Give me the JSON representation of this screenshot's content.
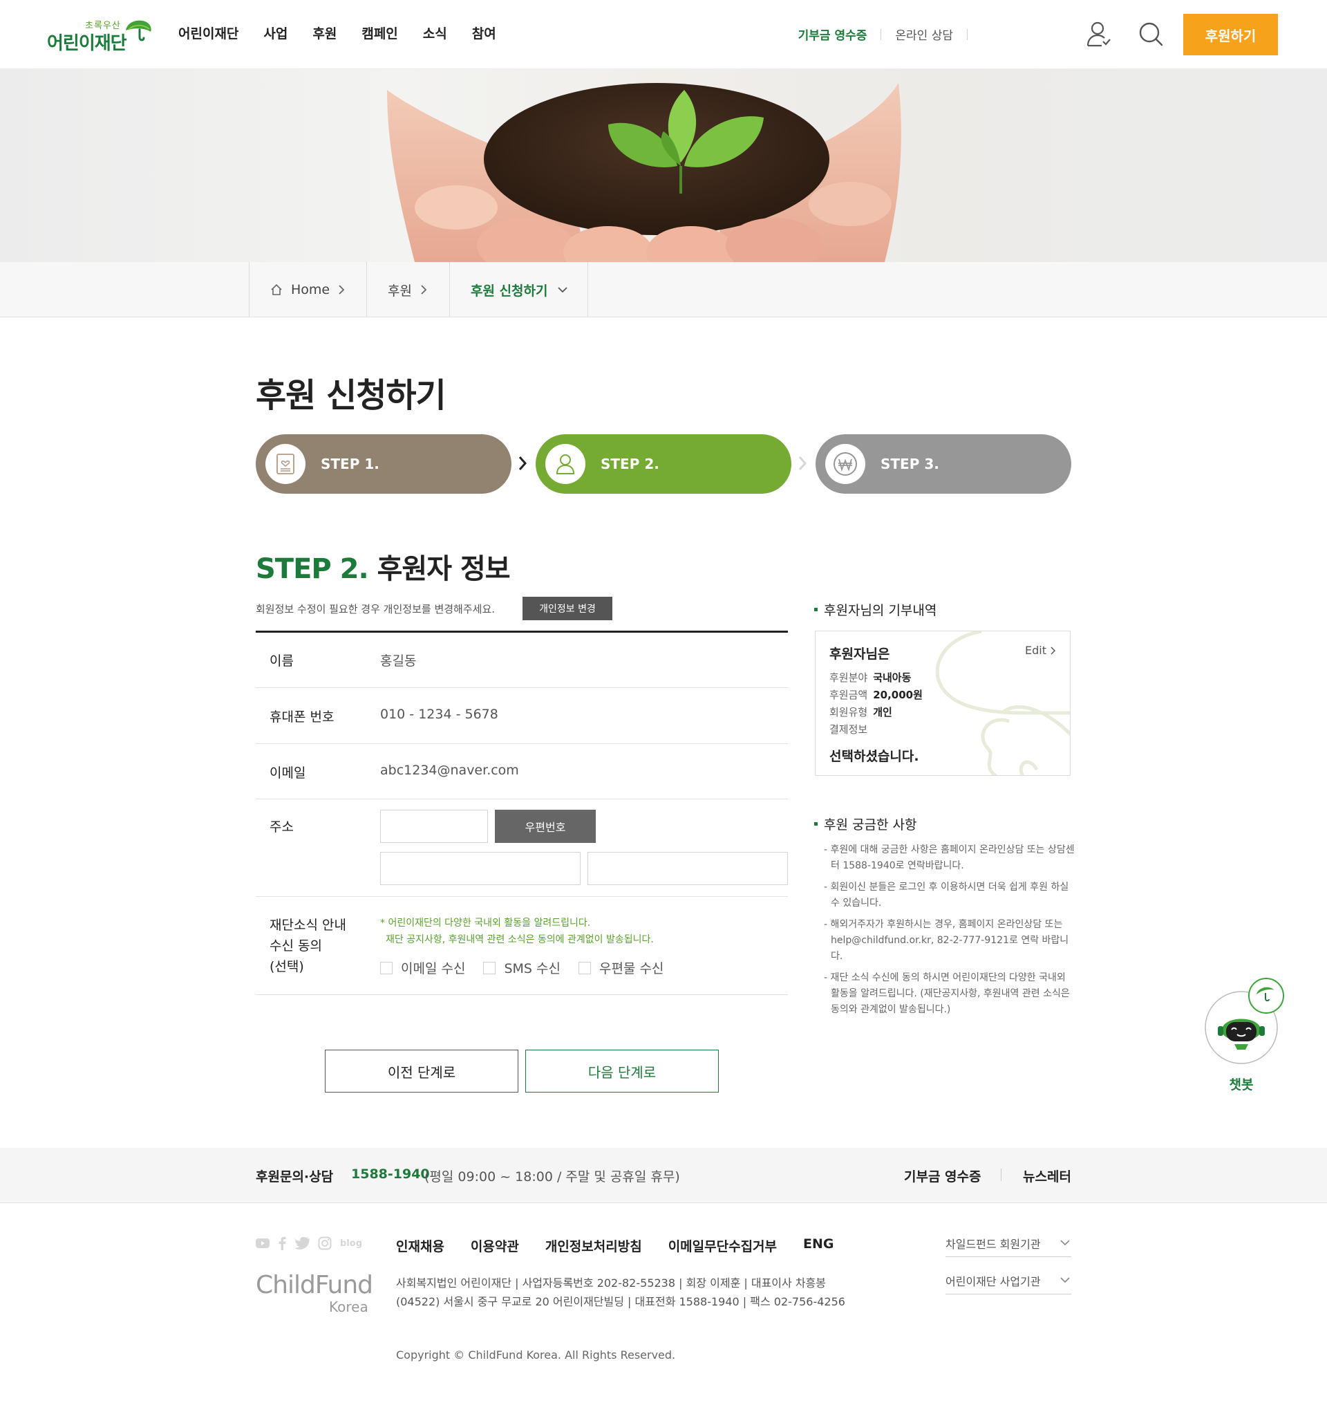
{
  "header": {
    "logo_small": "초록우산",
    "logo_main": "어린이재단",
    "nav": [
      "어린이재단",
      "사업",
      "후원",
      "캠페인",
      "소식",
      "참여"
    ],
    "receipt": "기부금 영수증",
    "consult": "온라인 상담",
    "donate_button": "후원하기"
  },
  "breadcrumb": {
    "home": "Home",
    "level1": "후원",
    "current": "후원 신청하기"
  },
  "page_title": "후원 신청하기",
  "steps": [
    {
      "label": "STEP 1.",
      "icon": "document-heart-icon",
      "color": "#928270"
    },
    {
      "label": "STEP 2.",
      "icon": "person-icon",
      "color": "#75ab32"
    },
    {
      "label": "STEP 3.",
      "icon": "won-coin-icon",
      "color": "#979797"
    }
  ],
  "section": {
    "step_label": "STEP 2.",
    "title": "후원자 정보",
    "note": "회원정보 수정이 필요한 경우 개인정보를 변경해주세요.",
    "change_button": "개인정보 변경"
  },
  "form": {
    "name_label": "이름",
    "name_value": "홍길동",
    "phone_label": "휴대폰 번호",
    "phone_value": "010 - 1234 - 5678",
    "email_label": "이메일",
    "email_value": "abc1234@naver.com",
    "address_label": "주소",
    "zip_button": "우편번호",
    "zip_value": "",
    "address1_value": "",
    "address2_value": "",
    "consent_label_1": "재단소식 안내",
    "consent_label_2": "수신 동의",
    "consent_label_3": "(선택)",
    "consent_notice_1": "* 어린이재단의 다양한 국내외 활동을 알려드립니다.",
    "consent_notice_2": "재단 공지사항, 후원내역 관련 소식은 동의에 관계없이 발송됩니다.",
    "checkboxes": [
      {
        "label": "이메일 수신",
        "checked": false
      },
      {
        "label": "SMS 수신",
        "checked": false
      },
      {
        "label": "우편물 수신",
        "checked": false
      }
    ]
  },
  "buttons": {
    "prev": "이전 단계로",
    "next": "다음 단계로"
  },
  "sidebar": {
    "history_title": "후원자님의 기부내역",
    "summary_title": "후원자님은",
    "edit": "Edit",
    "rows": [
      {
        "key": "후원분야",
        "value": "국내아동"
      },
      {
        "key": "후원금액",
        "value": "20,000원"
      },
      {
        "key": "회원유형",
        "value": "개인"
      },
      {
        "key": "결제정보",
        "value": ""
      }
    ],
    "summary_end": "선택하셨습니다.",
    "faq_title": "후원 궁금한 사항",
    "faq": [
      "- 후원에 대해 궁금한 사항은 홈페이지 온라인상담 또는 상담센터 1588-1940로 연락바랍니다.",
      "- 회원이신 분들은 로그인 후 이용하시면 더욱 쉽게 후원 하실 수 있습니다.",
      "- 해외거주자가 후원하시는 경우, 홈페이지 온라인상담 또는 help@childfund.or.kr, 82-2-777-9121로 연락 바랍니다.",
      "- 재단 소식 수신에 동의 하시면 어린이재단의 다양한 국내외 활동을 알려드립니다. (재단공지사항, 후원내역 관련 소식은 동의와 관계없이 발송됩니다.)"
    ]
  },
  "chatbot": {
    "label": "챗봇"
  },
  "footer": {
    "contact_title": "후원문의·상담",
    "contact_phone": "1588-1940",
    "contact_hours": "(평일 09:00 ~ 18:00 / 주말 및 공휴일 휴무)",
    "receipt_link": "기부금 영수증",
    "newsletter_link": "뉴스레터",
    "sns": [
      "youtube-icon",
      "facebook-icon",
      "twitter-icon",
      "instagram-icon",
      "blog-icon"
    ],
    "blog_text": "blog",
    "links": [
      "인재채용",
      "이용약관",
      "개인정보처리방침",
      "이메일무단수집거부",
      "ENG"
    ],
    "logo_main": "ChildFund",
    "logo_sub": "Korea",
    "address_1": "사회복지법인 어린이재단 | 사업자등록번호 202-82-55238 | 회장 이제훈 | 대표이사 차흥봉",
    "address_2": "(04522) 서울시 중구 무교로 20 어린이재단빌딩 | 대표전화 1588-1940 | 팩스 02-756-4256",
    "copyright": "Copyright © ChildFund Korea. All Rights Reserved.",
    "select_1": "차일드펀드 회원기관",
    "select_2": "어린이재단 사업기관"
  }
}
